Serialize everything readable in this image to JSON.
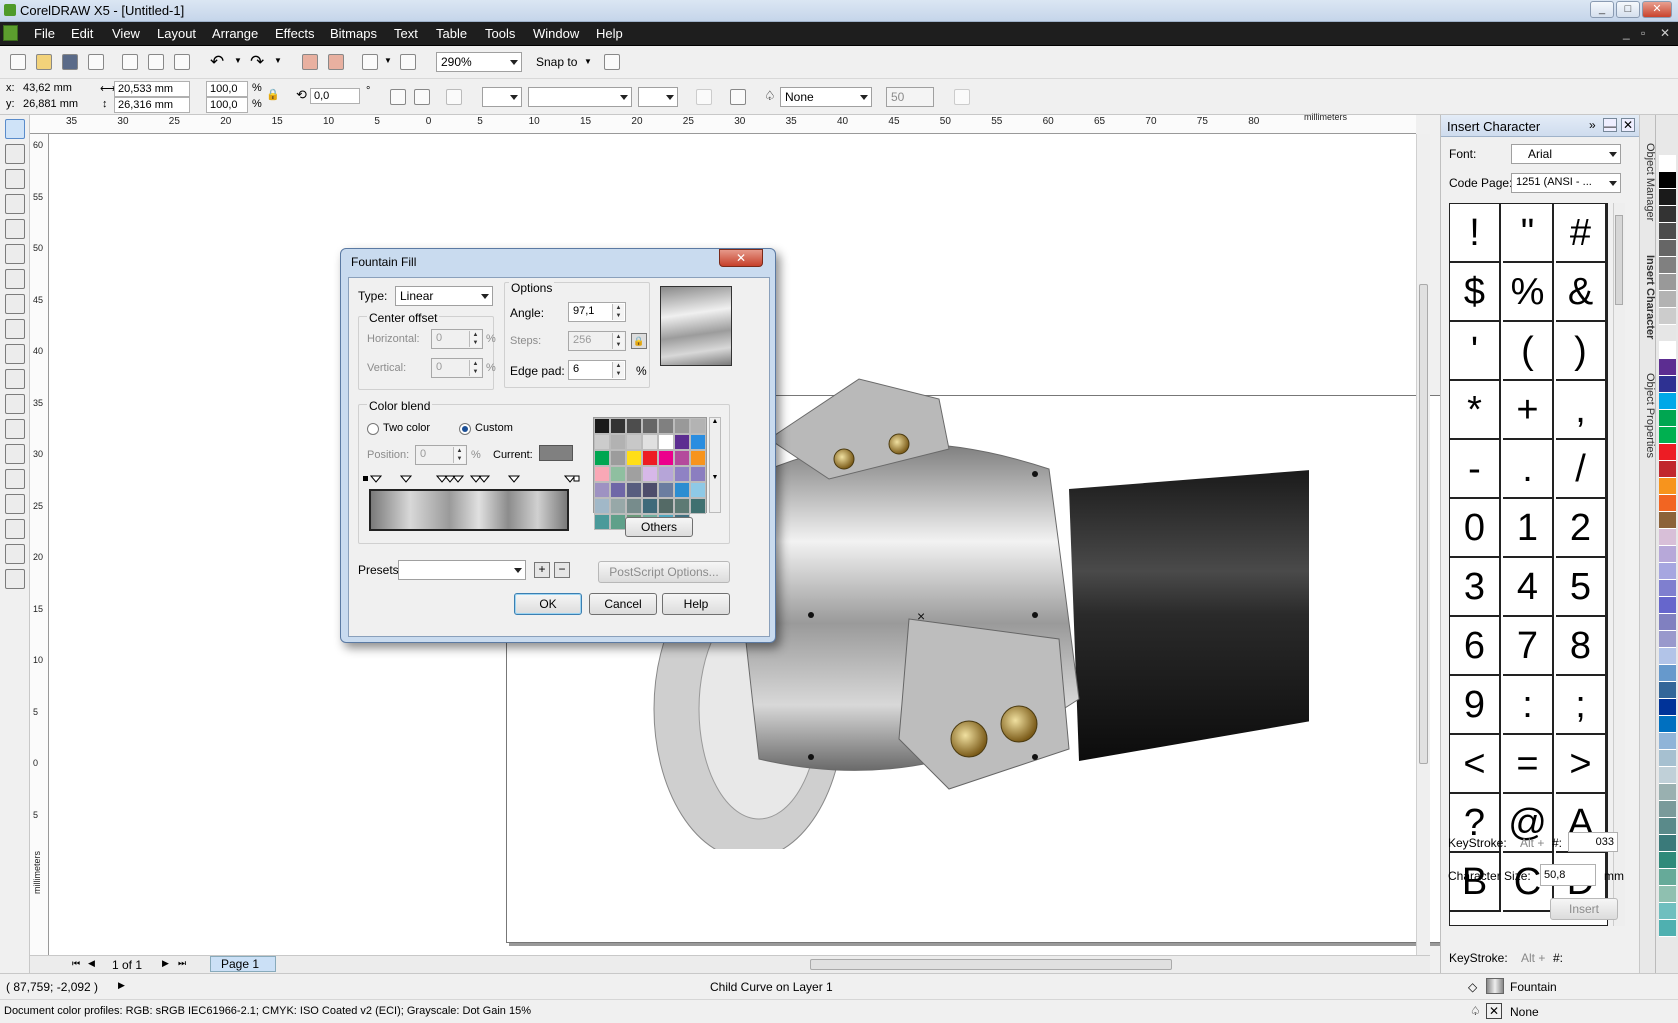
{
  "window": {
    "title": "CorelDRAW X5 - [Untitled-1]"
  },
  "menus": [
    "File",
    "Edit",
    "View",
    "Layout",
    "Arrange",
    "Effects",
    "Bitmaps",
    "Text",
    "Table",
    "Tools",
    "Window",
    "Help"
  ],
  "toolbar": {
    "zoom": "290%",
    "snap_to": "Snap to"
  },
  "propbar": {
    "x": "x:",
    "x_val": "43,62 mm",
    "y": "y:",
    "y_val": "26,881 mm",
    "w_val": "20,533 mm",
    "h_val": "26,316 mm",
    "scale_x": "100,0",
    "scale_y": "100,0",
    "pct": "%",
    "rotation": "0,0",
    "deg": "°",
    "outline": "None",
    "size": "50"
  },
  "ruler": {
    "units": "millimeters",
    "h_ticks": [
      "35",
      "30",
      "25",
      "20",
      "15",
      "10",
      "5",
      "0",
      "5",
      "10",
      "15",
      "20",
      "25",
      "30",
      "35",
      "40",
      "45",
      "50",
      "55",
      "60",
      "65",
      "70",
      "75",
      "80"
    ],
    "v_ticks": [
      "60",
      "55",
      "50",
      "45",
      "40",
      "35",
      "30",
      "25",
      "20",
      "15",
      "10",
      "5",
      "0",
      "5"
    ]
  },
  "nav": {
    "pages": "1 of 1",
    "page_tab": "Page 1"
  },
  "status": {
    "coords": "( 87,759; -2,092 )",
    "selection": "Child Curve on Layer 1",
    "profiles": "Document color profiles: RGB: sRGB IEC61966-2.1; CMYK: ISO Coated v2 (ECI); Grayscale: Dot Gain 15%",
    "fill": "Fountain",
    "outline": "None"
  },
  "docker": {
    "title": "Insert Character",
    "font_label": "Font:",
    "font": "Arial",
    "codepage_label": "Code Page:",
    "codepage": "1251  (ANSI - ...",
    "chars": [
      "!",
      "\"",
      "#",
      "$",
      "%",
      "&",
      "'",
      "(",
      ")",
      "*",
      "+",
      ",",
      "-",
      ".",
      "/",
      "0",
      "1",
      "2",
      "3",
      "4",
      "5",
      "6",
      "7",
      "8",
      "9",
      ":",
      ";",
      "<",
      "=",
      ">",
      "?",
      "@",
      "A",
      "B",
      "C",
      "D"
    ],
    "keystroke_label": "KeyStroke:",
    "alt": "Alt +",
    "hash": "#:",
    "keystroke": "033",
    "size_label": "Character Size:",
    "size": "50,8",
    "unit": "mm",
    "insert": "Insert",
    "tabs": [
      "Object Manager",
      "Insert Character",
      "Object Properties"
    ]
  },
  "dialog": {
    "title": "Fountain Fill",
    "type_label": "Type:",
    "type": "Linear",
    "center_offset": "Center offset",
    "horizontal": "Horizontal:",
    "horizontal_val": "0",
    "vertical": "Vertical:",
    "vertical_val": "0",
    "pct": "%",
    "options": "Options",
    "angle": "Angle:",
    "angle_val": "97,1",
    "steps": "Steps:",
    "steps_val": "256",
    "edge_pad": "Edge pad:",
    "edge_pad_val": "6",
    "color_blend": "Color blend",
    "two_color": "Two color",
    "custom": "Custom",
    "position": "Position:",
    "position_val": "0",
    "current": "Current:",
    "others": "Others",
    "presets": "Presets:",
    "postscript": "PostScript Options...",
    "ok": "OK",
    "cancel": "Cancel",
    "help": "Help",
    "swatches": [
      "#1a1a1a",
      "#333333",
      "#4d4d4d",
      "#666666",
      "#808080",
      "#999999",
      "#b3b3b3",
      "#cccccc",
      "#b2b2b2",
      "#c8c8c8",
      "#e0e0e0",
      "#ffffff",
      "#5c2d91",
      "#2a8de0",
      "#00a651",
      "#9c9c9c",
      "#ffde17",
      "#ed1c24",
      "#ec008c",
      "#b44a9c",
      "#f7941d",
      "#f9a8b6",
      "#8fbfa0",
      "#a0a0a0",
      "#d7b8e8",
      "#b6a5d8",
      "#8f82c4",
      "#8b7ec0",
      "#9e92c2",
      "#6f67a7",
      "#585d7f",
      "#4d4d6b",
      "#6b7da0",
      "#2b8dd1",
      "#8ec9e6",
      "#a1b8c8",
      "#97a8a8",
      "#778c8c",
      "#3f6a7a",
      "#546a66",
      "#5d7a74",
      "#3f7070",
      "#4a9a9a",
      "#5fa08a",
      "#6a9a7a",
      "#70b0a0",
      "#4fa8c0",
      "#407080"
    ]
  },
  "palette": [
    "#ffffff",
    "#000000",
    "#1a1a1a",
    "#333333",
    "#4d4d4d",
    "#666666",
    "#808080",
    "#999999",
    "#b3b3b3",
    "#cccccc",
    "#e6e6e6",
    "#ffffff",
    "#5c2d91",
    "#2e3192",
    "#00a8e8",
    "#00a651",
    "#00b050",
    "#ed1c24",
    "#c1272d",
    "#f7941d",
    "#f26522",
    "#8c6239",
    "#d8bfd8",
    "#b7a8d9",
    "#a6a6e0",
    "#7f7fcf",
    "#6666cc",
    "#8080c0",
    "#9999cc",
    "#b2c4e8",
    "#6699cc",
    "#336699",
    "#003399",
    "#0070c0",
    "#8fb4d8",
    "#a6c0d0",
    "#c0d0d8",
    "#99b0b0",
    "#7a9a9a",
    "#5a8a8a",
    "#3a7a7a",
    "#2f8a7a",
    "#66aa99",
    "#8fc0b0",
    "#6fbfbf",
    "#4fb0b0"
  ]
}
